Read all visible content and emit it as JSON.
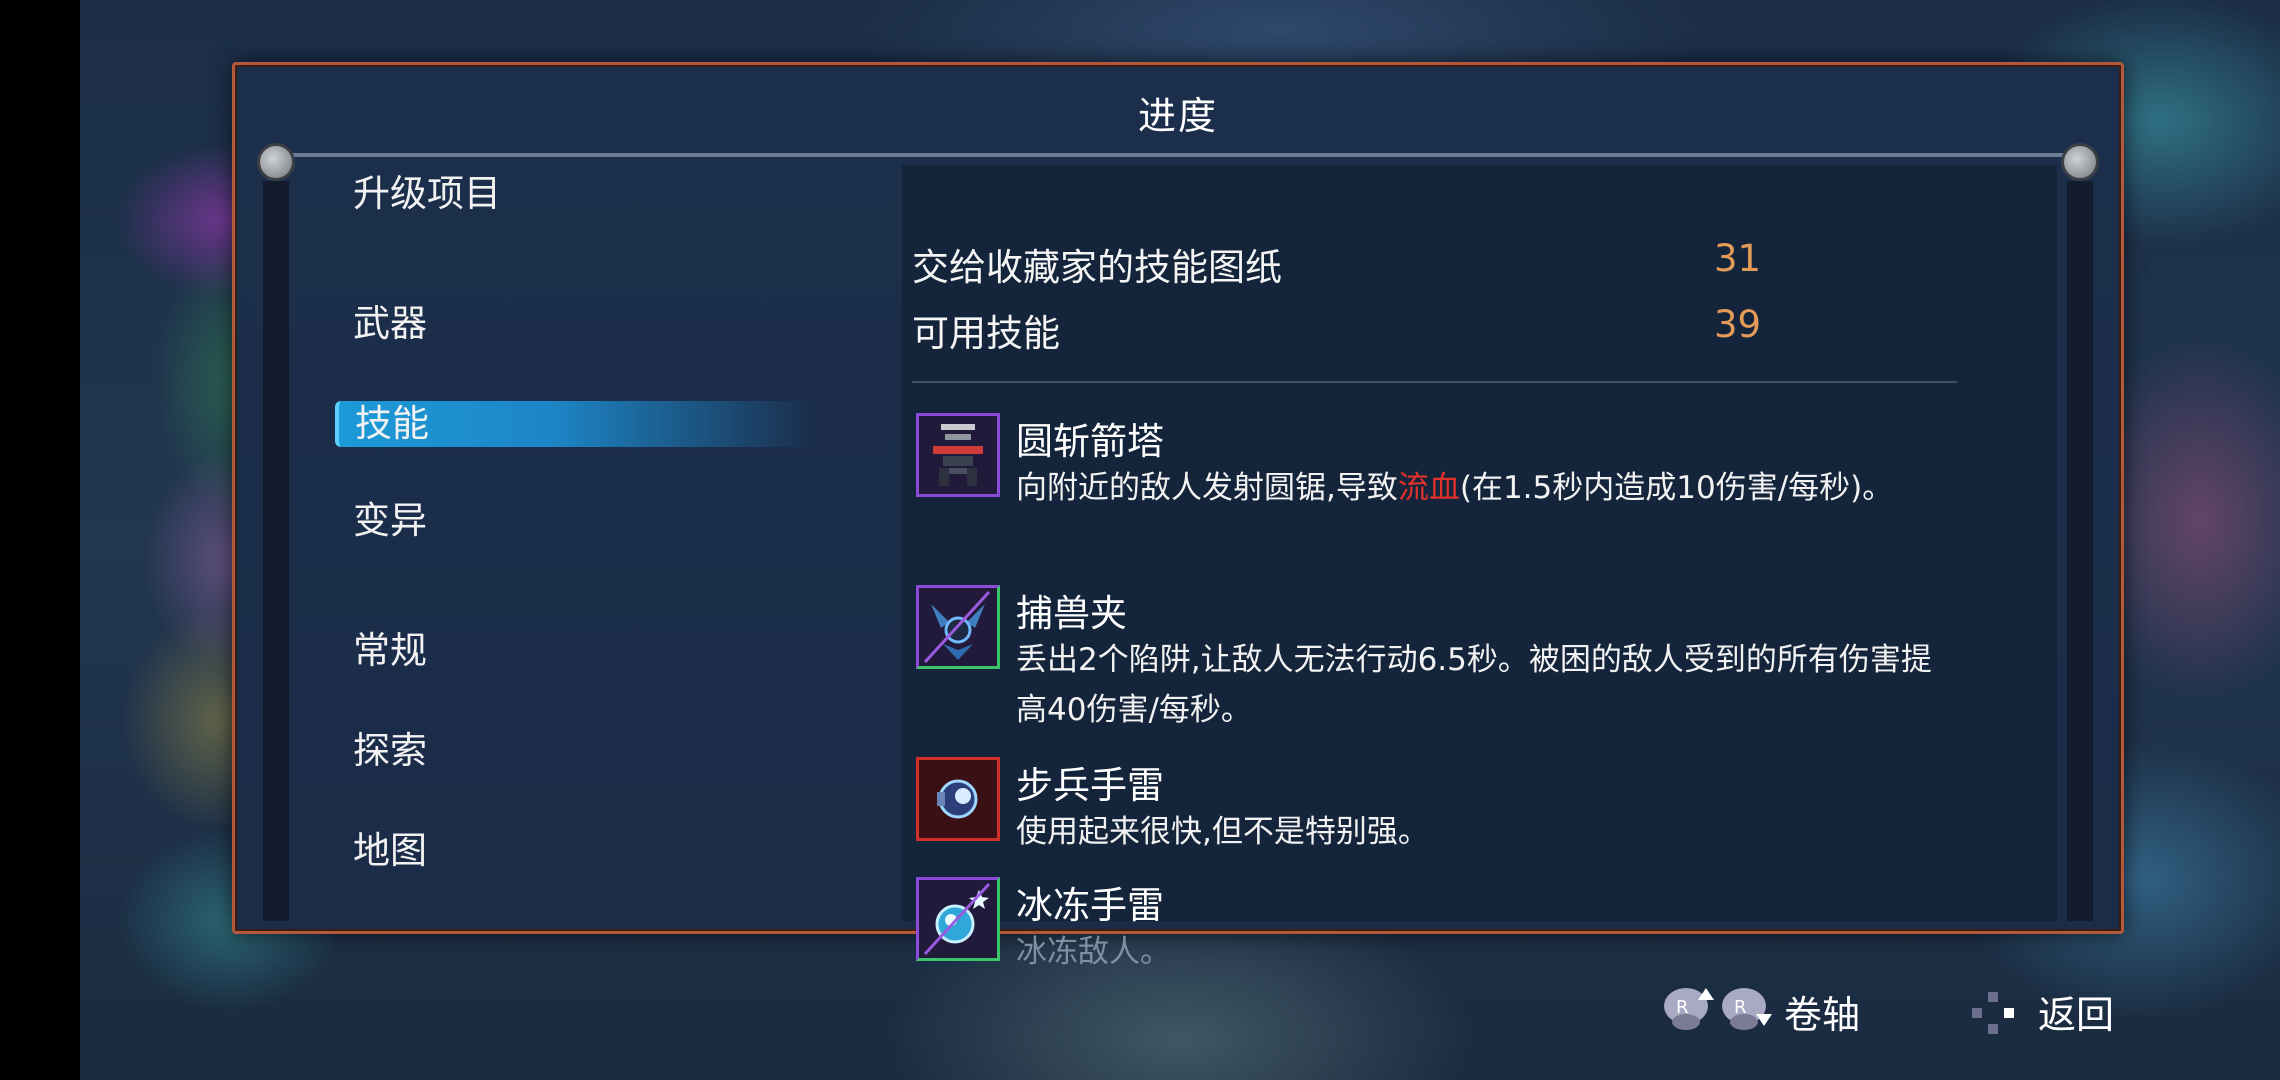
{
  "window": {
    "title": "进度"
  },
  "sidebar": {
    "items": [
      {
        "label": "升级项目"
      },
      {
        "label": "武器"
      },
      {
        "label": "技能"
      },
      {
        "label": "变异"
      },
      {
        "label": "常规"
      },
      {
        "label": "探索"
      },
      {
        "label": "地图"
      }
    ],
    "selected": "技能"
  },
  "stats": [
    {
      "label": "交给收藏家的技能图纸",
      "value": "31"
    },
    {
      "label": "可用技能",
      "value": "39"
    }
  ],
  "skills": [
    {
      "name": "圆斩箭塔",
      "desc_before": "向附近的敌人发射圆锯,导致",
      "desc_highlight": "流血",
      "desc_after": "(在1.5秒内造成10伤害/每秒)。",
      "icon": "saw-turret-icon"
    },
    {
      "name": "捕兽夹",
      "desc": "丢出2个陷阱,让敌人无法行动6.5秒。被困的敌人受到的所有伤害提高40伤害/每秒。",
      "icon": "wolf-trap-icon"
    },
    {
      "name": "步兵手雷",
      "desc": "使用起来很快,但不是特别强。",
      "icon": "infantry-grenade-icon"
    },
    {
      "name": "冰冻手雷",
      "desc": "冰冻敌人。",
      "icon": "ice-grenade-icon"
    }
  ],
  "footer": {
    "scroll_label": "卷轴",
    "back_label": "返回"
  },
  "colors": {
    "accent_selected": "#1d9ad8",
    "value_orange": "#e39b57",
    "bleed_red": "#e3312b",
    "panel_border": "#b2593a"
  }
}
